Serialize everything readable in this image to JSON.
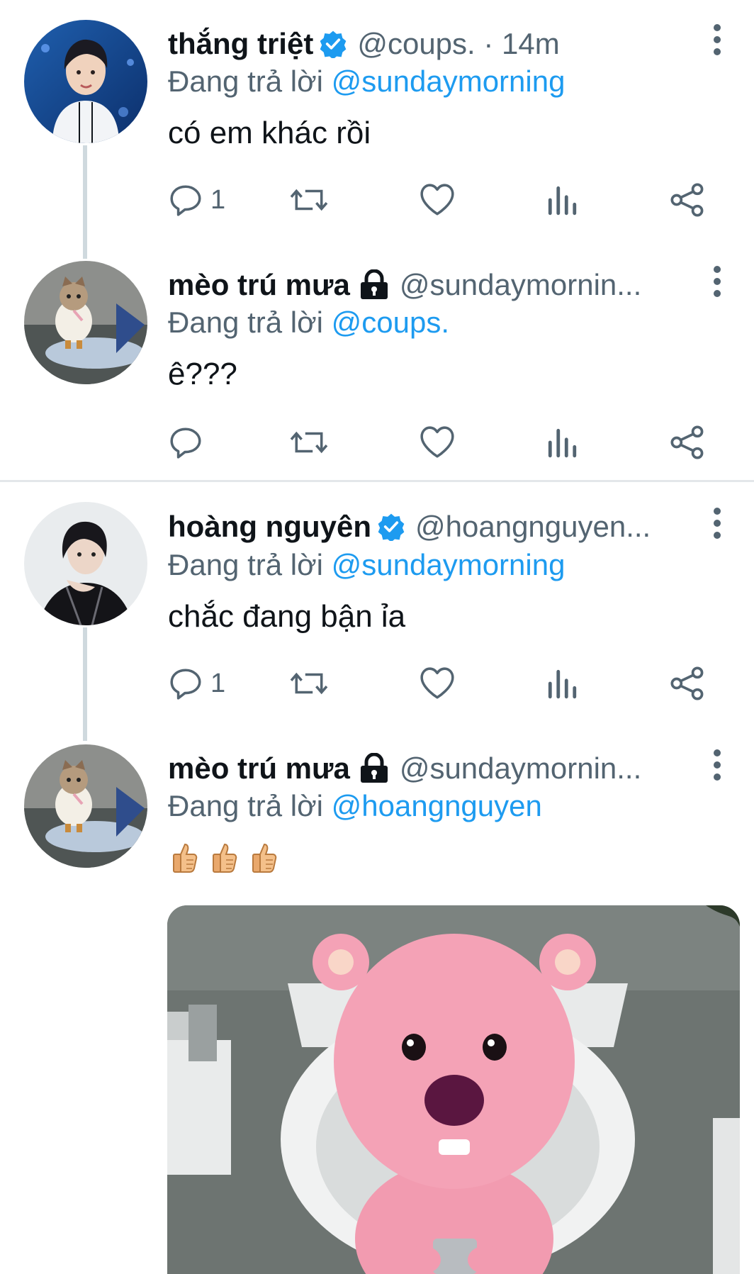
{
  "reply_prefix": "Đang trả lời",
  "tweets": [
    {
      "name": "thắng triệt",
      "verified": true,
      "handle": "@coups. · 14m",
      "reply_to": "@sundaymorning",
      "text": "có em khác rồi",
      "reply_count": "1",
      "avatar": "profile-photo"
    },
    {
      "name": "mèo trú mưa",
      "locked": true,
      "handle": "@sundaymornin...",
      "reply_to": "@coups.",
      "text": "ê???",
      "reply_count": "",
      "avatar": "cat-photo"
    },
    {
      "name": "hoàng nguyên",
      "verified": true,
      "handle": "@hoangnguyen...",
      "reply_to": "@sundaymorning",
      "text": "chắc đang bận ỉa",
      "reply_count": "1",
      "avatar": "profile-photo"
    },
    {
      "name": "mèo trú mưa",
      "locked": true,
      "handle": "@sundaymornin...",
      "reply_to": "@hoangnguyen",
      "emojis": "👍👍👍",
      "media": "pink-beaver-on-toilet-image",
      "avatar": "cat-photo"
    }
  ],
  "icons": [
    "reply-icon",
    "retweet-icon",
    "like-icon",
    "views-icon",
    "share-icon",
    "verified-badge-icon",
    "lock-icon",
    "more-icon"
  ],
  "colors": {
    "accent": "#1d9bf0",
    "secondary_text": "#536471",
    "thread_line": "#cfd9de"
  }
}
